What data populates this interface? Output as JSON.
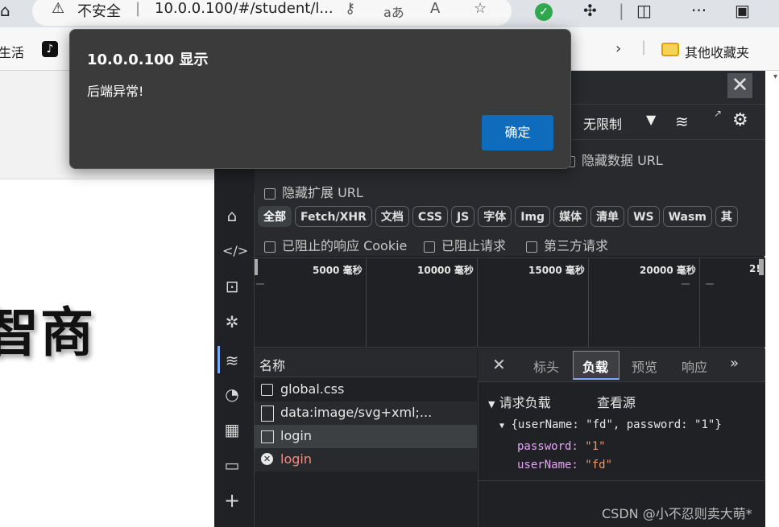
{
  "browser": {
    "security_label": "不安全",
    "address": "10.0.0.100/#/student/l...",
    "bookmarks": {
      "left_fragment": "生活",
      "other_folder": "其他收藏夹"
    }
  },
  "page": {
    "big_text": "智商"
  },
  "dialog": {
    "title": "10.0.0.100 显示",
    "message": "后端异常!",
    "ok_label": "确定"
  },
  "devtools": {
    "throttle": "无限制",
    "hide_data_url": "隐藏数据 URL",
    "hide_ext_url": "隐藏扩展 URL",
    "filters": [
      "全部",
      "Fetch/XHR",
      "文档",
      "CSS",
      "JS",
      "字体",
      "Img",
      "媒体",
      "清单",
      "WS",
      "Wasm",
      "其"
    ],
    "blocked_cookie": "已阻止的响应 Cookie",
    "blocked_request": "已阻止请求",
    "third_party": "第三方请求",
    "timeline_labels": [
      "5000 毫秒",
      "10000 毫秒",
      "15000 毫秒",
      "20000 毫秒",
      "2!"
    ],
    "list_header": "名称",
    "requests": [
      {
        "name": "global.css",
        "status": "ok"
      },
      {
        "name": "data:image/svg+xml;...",
        "status": "ok"
      },
      {
        "name": "login",
        "status": "ok"
      },
      {
        "name": "login",
        "status": "error"
      }
    ],
    "detail_tabs": [
      "标头",
      "负载",
      "预览",
      "响应"
    ],
    "active_tab": "负载",
    "payload": {
      "section": "请求负载",
      "view_source": "查看源",
      "summary": "{userName: \"fd\", password: \"1\"}",
      "password_key": "password:",
      "password_val": "\"1\"",
      "username_key": "userName:",
      "username_val": "\"fd\""
    }
  },
  "watermark": "CSDN @小不忍则卖大萌*",
  "colors": {
    "accent": "#0f6cbd",
    "error": "#f28b82",
    "devtools_bg": "#202124"
  }
}
